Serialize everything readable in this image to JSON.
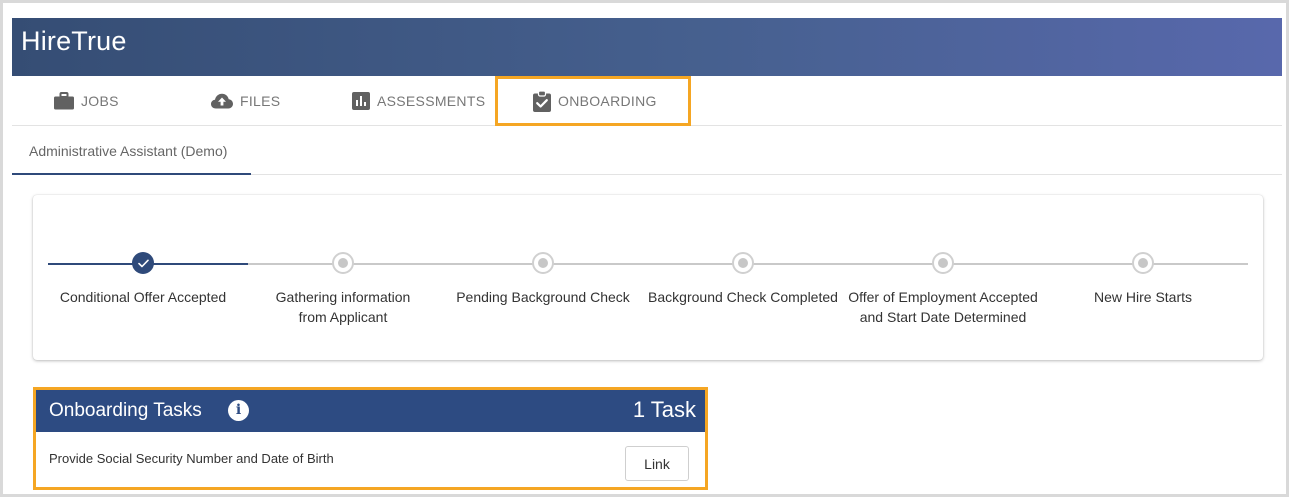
{
  "app": {
    "title": "HireTrue"
  },
  "nav": {
    "tabs": [
      {
        "label": "JOBS",
        "icon": "briefcase-icon"
      },
      {
        "label": "FILES",
        "icon": "cloud-upload-icon"
      },
      {
        "label": "ASSESSMENTS",
        "icon": "bar-chart-icon"
      },
      {
        "label": "ONBOARDING",
        "icon": "clipboard-check-icon",
        "active": true
      }
    ]
  },
  "subtabs": [
    {
      "label": "Administrative Assistant (Demo)",
      "active": true
    }
  ],
  "stepper": {
    "steps": [
      {
        "label": "Conditional Offer Accepted",
        "status": "completed"
      },
      {
        "label": "Gathering information from Applicant",
        "status": "pending"
      },
      {
        "label": "Pending Background Check",
        "status": "pending"
      },
      {
        "label": "Background Check Completed",
        "status": "pending"
      },
      {
        "label": "Offer of Employment Accepted and Start Date Determined",
        "status": "pending"
      },
      {
        "label": "New Hire Starts",
        "status": "pending"
      }
    ]
  },
  "tasks": {
    "title": "Onboarding Tasks",
    "count_label": "1 Task",
    "items": [
      {
        "text": "Provide Social Security Number and Date of Birth",
        "action_label": "Link"
      }
    ]
  },
  "colors": {
    "primary": "#2d4b82",
    "highlight": "#f5a623",
    "completed_step": "#2f4a7a",
    "pending_step": "#c7c7c7"
  }
}
